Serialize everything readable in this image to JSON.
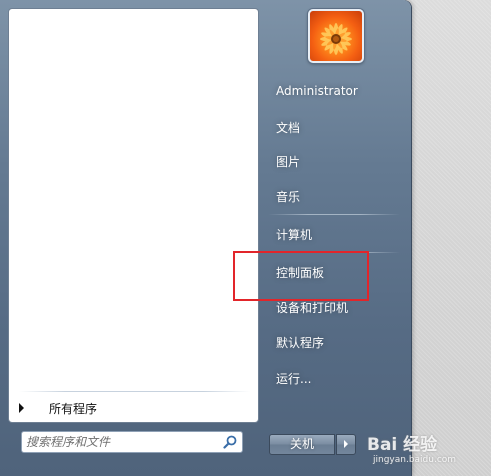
{
  "start_menu": {
    "left_pane": {
      "all_programs_label": "所有程序",
      "search": {
        "placeholder": "搜索程序和文件",
        "value": "",
        "icon": "search-icon"
      }
    },
    "user": {
      "name": "Administrator",
      "avatar_icon": "flower-avatar"
    },
    "right_items": {
      "documents": "文档",
      "pictures": "图片",
      "music": "音乐",
      "computer": "计算机",
      "control_panel": "控制面板",
      "devices_printers": "设备和打印机",
      "default_programs": "默认程序",
      "run": "运行..."
    },
    "shutdown": {
      "label": "关机",
      "arrow_icon": "chevron-right-icon"
    }
  },
  "annotation": {
    "highlight_target": "控制面板",
    "highlight_color": "#e2252a"
  },
  "watermark": {
    "brand": "Bai 经验",
    "url": "jingyan.baidu.com"
  }
}
